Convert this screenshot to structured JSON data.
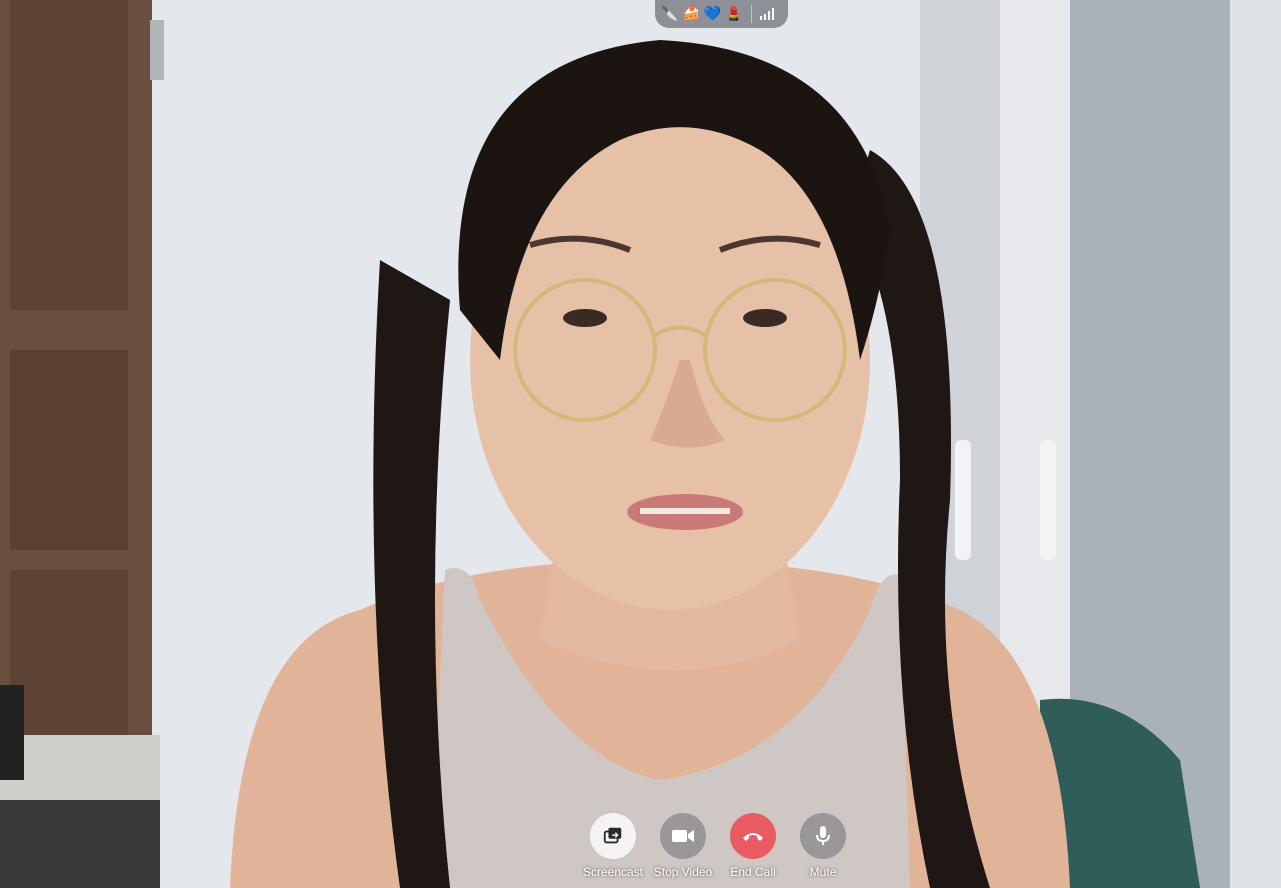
{
  "call": {
    "controls": [
      {
        "id": "screencast",
        "label": "Screencast",
        "icon": "screencast-icon",
        "style": "light"
      },
      {
        "id": "stop-video",
        "label": "Stop Video",
        "icon": "video-camera-icon",
        "style": "gray"
      },
      {
        "id": "end-call",
        "label": "End Call",
        "icon": "phone-hangup-icon",
        "style": "red"
      },
      {
        "id": "mute",
        "label": "Mute",
        "icon": "microphone-icon",
        "style": "gray"
      }
    ],
    "encryption_emojis": [
      "🔪",
      "🍰",
      "💙",
      "💄"
    ],
    "signal": {
      "icon": "signal-strength-icon",
      "bars_active": 4,
      "bars_total": 4
    }
  },
  "colors": {
    "end_call": "#e85b62",
    "screencast_bg": "#f4f4f4",
    "control_bg": "#6e7076"
  }
}
